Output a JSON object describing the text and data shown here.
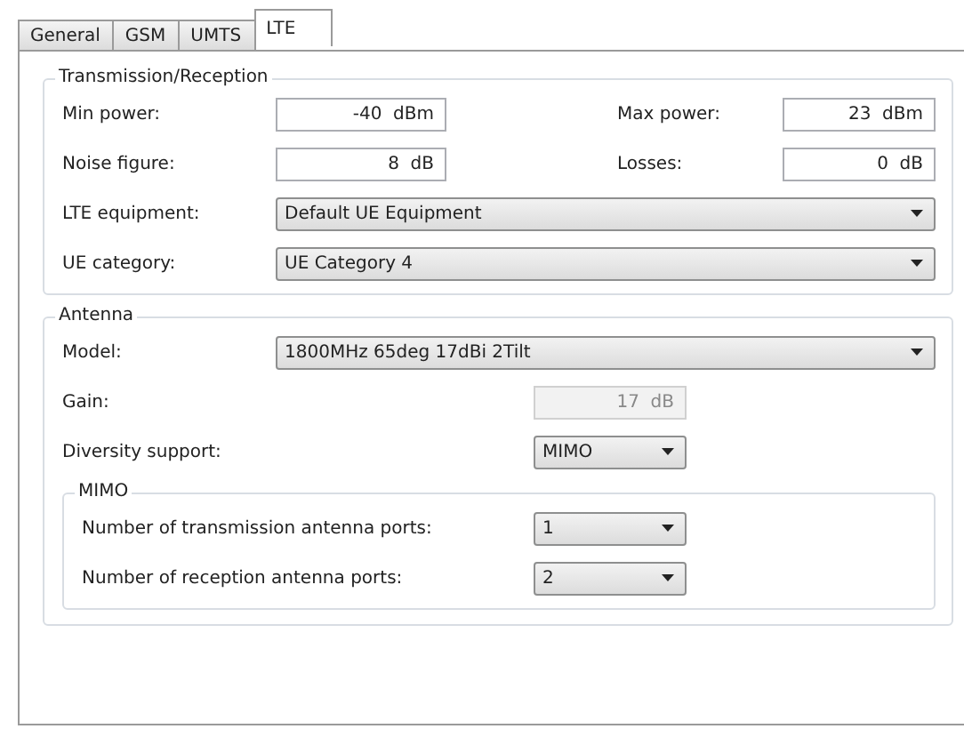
{
  "tabs": [
    {
      "label": "General",
      "selected": false
    },
    {
      "label": "GSM",
      "selected": false
    },
    {
      "label": "UMTS",
      "selected": false
    },
    {
      "label": "LTE",
      "selected": true
    }
  ],
  "transmission": {
    "title": "Transmission/Reception",
    "min_power": {
      "label": "Min power:",
      "value": "-40  dBm"
    },
    "max_power": {
      "label": "Max power:",
      "value": "23  dBm"
    },
    "noise_figure": {
      "label": "Noise figure:",
      "value": "8  dB"
    },
    "losses": {
      "label": "Losses:",
      "value": "0  dB"
    },
    "lte_equipment": {
      "label": "LTE equipment:",
      "value": "Default UE Equipment"
    },
    "ue_category": {
      "label": "UE category:",
      "value": "UE Category 4"
    }
  },
  "antenna": {
    "title": "Antenna",
    "model": {
      "label": "Model:",
      "value": "1800MHz 65deg 17dBi 2Tilt"
    },
    "gain": {
      "label": "Gain:",
      "value": "17  dB",
      "disabled": true
    },
    "diversity": {
      "label": "Diversity support:",
      "value": "MIMO"
    },
    "mimo": {
      "title": "MIMO",
      "tx_ports": {
        "label": "Number of transmission antenna ports:",
        "value": "1"
      },
      "rx_ports": {
        "label": "Number of reception antenna ports:",
        "value": "2"
      }
    }
  }
}
